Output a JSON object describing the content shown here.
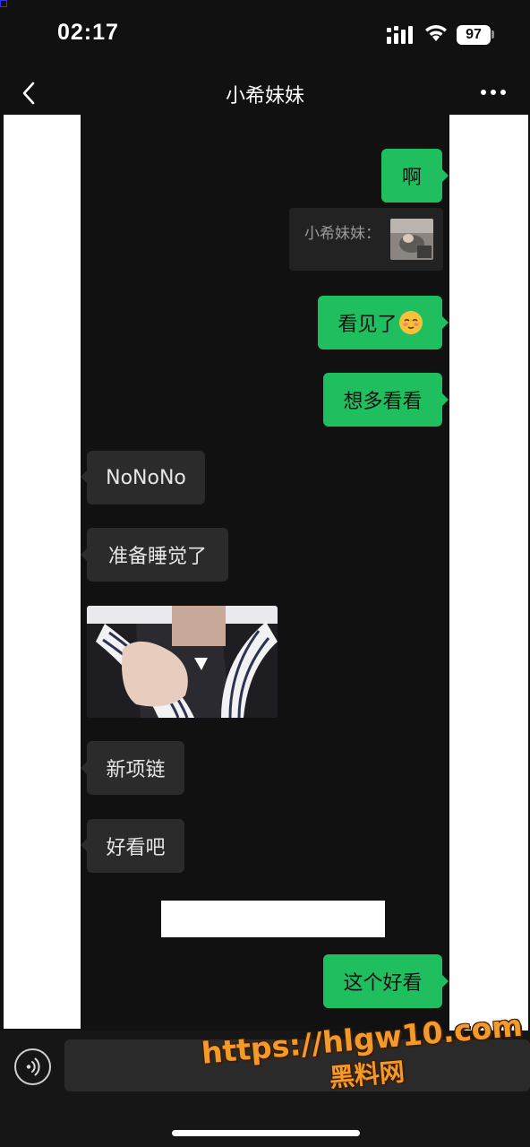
{
  "status_bar": {
    "time": "02:17",
    "battery": "97",
    "icons": [
      "cellular-signal-icon",
      "wifi-icon",
      "battery-icon"
    ]
  },
  "nav": {
    "title": "小希妹妹",
    "back_icon": "chevron-left-icon",
    "more_icon": "more-dots-icon"
  },
  "messages": [
    {
      "side": "out",
      "text": "啊"
    },
    {
      "side": "quote",
      "text": "小希妹妹：",
      "thumbnail": "image"
    },
    {
      "side": "out",
      "text": "看见了",
      "emoji": "blush-face-emoji"
    },
    {
      "side": "out",
      "text": "想多看看"
    },
    {
      "side": "in",
      "text": "NoNoNo"
    },
    {
      "side": "in",
      "text": "准备睡觉了"
    },
    {
      "side": "in",
      "type": "photo"
    },
    {
      "side": "in",
      "text": "新项链"
    },
    {
      "side": "in",
      "text": "好看吧"
    },
    {
      "side": "out",
      "text": "这个好看"
    }
  ],
  "input": {
    "voice_icon": "voice-icon",
    "value": ""
  },
  "watermark": {
    "url": "https://hlgw10.com",
    "name": "黑料网"
  },
  "colors": {
    "outgoing_bubble": "#1fbf5f",
    "incoming_bubble": "#2b2b2b",
    "background": "#111111",
    "watermark": "#f39a2a"
  }
}
